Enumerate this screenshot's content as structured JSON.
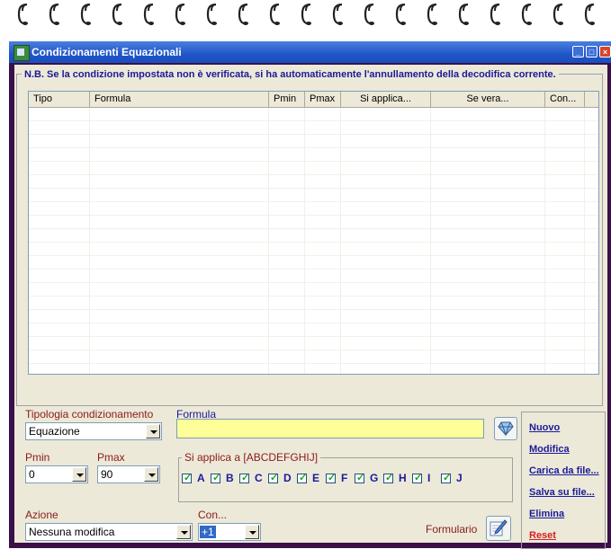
{
  "window": {
    "title": "Condizionamenti Equazionali"
  },
  "notice": "N.B. Se la condizione impostata non è verificata, si ha automaticamente l'annullamento della decodifica corrente.",
  "grid": {
    "columns": [
      "Tipo",
      "Formula",
      "Pmin",
      "Pmax",
      "Si applica...",
      "Se vera...",
      "Con..."
    ]
  },
  "form": {
    "tipologia_label": "Tipologia condizionamento",
    "tipologia_value": "Equazione",
    "formula_label": "Formula",
    "formula_value": "",
    "pmin_label": "Pmin",
    "pmin_value": "0",
    "pmax_label": "Pmax",
    "pmax_value": "90",
    "applica_legend": "Si applica a [ABCDEFGHIJ]",
    "checks": [
      "A",
      "B",
      "C",
      "D",
      "E",
      "F",
      "G",
      "H",
      "I",
      "J"
    ],
    "azione_label": "Azione",
    "azione_value": "Nessuna modifica",
    "con_label": "Con...",
    "con_value": "+1",
    "formulario_label": "Formulario"
  },
  "links": {
    "nuovo": "Nuovo",
    "modifica": "Modifica",
    "carica": "Carica da file...",
    "salva": "Salva su file...",
    "elimina": "Elimina",
    "reset": "Reset"
  },
  "colors": {
    "title_bar": "#1f55c8",
    "label_red": "#8b1a1a",
    "label_blue": "#1a1a9a",
    "formula_bg": "#ffff99",
    "reset": "#d42020"
  },
  "icons": [
    "spiral-ring-icon",
    "app-icon",
    "minimize-icon",
    "maximize-icon",
    "close-icon",
    "gem-icon",
    "pencil-icon"
  ]
}
